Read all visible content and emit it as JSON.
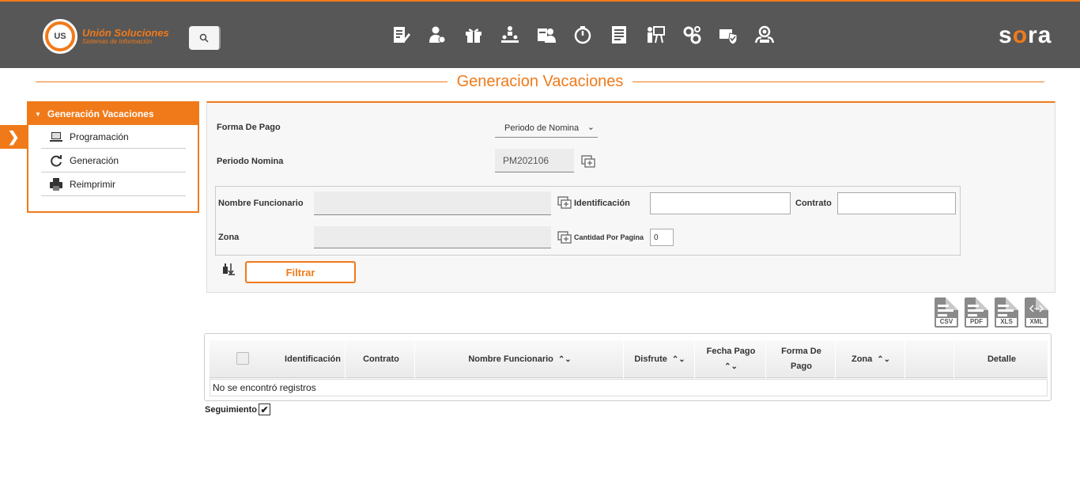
{
  "header": {
    "logo_mark": "US",
    "logo_title": "Unión Soluciones",
    "logo_subtitle": "Sistemas de Información",
    "brand_pre": "s",
    "brand_accent": "o",
    "brand_post": "ra",
    "modules": [
      "edit-doc-icon",
      "user-money-icon",
      "gift-icon",
      "org-chart-icon",
      "user-id-icon",
      "timer-icon",
      "document-list-icon",
      "presentation-icon",
      "gears-icon",
      "shield-check-icon",
      "team-search-icon"
    ]
  },
  "page": {
    "title": "Generacion Vacaciones"
  },
  "sidebar": {
    "title": "Generación Vacaciones",
    "items": [
      {
        "label": "Programación",
        "icon": "laptop-icon"
      },
      {
        "label": "Generación",
        "icon": "refresh-icon"
      },
      {
        "label": "Reimprimir",
        "icon": "printer-icon"
      }
    ]
  },
  "form": {
    "forma_pago_label": "Forma De Pago",
    "forma_pago_value": "Periodo de Nomina",
    "periodo_label": "Periodo Nomina",
    "periodo_value": "PM202106",
    "nombre_label": "Nombre Funcionario",
    "nombre_value": "",
    "identificacion_label": "Identificación",
    "identificacion_value": "",
    "contrato_label": "Contrato",
    "contrato_value": "",
    "zona_label": "Zona",
    "zona_value": "",
    "cantidad_label": "Cantidad Por Pagina",
    "cantidad_value": "0",
    "filtrar_label": "Filtrar"
  },
  "exports": [
    "CSV",
    "PDF",
    "XLS",
    "XML"
  ],
  "table": {
    "columns": [
      "Identificación",
      "Contrato",
      "Nombre Funcionario",
      "Disfrute",
      "Fecha Pago",
      "Forma De Pago",
      "Zona",
      "Detalle"
    ],
    "empty_message": "No se encontró registros"
  },
  "footer": {
    "seguimiento_label": "Seguimiento",
    "seguimiento_checked": true
  },
  "colors": {
    "accent": "#f07a1a",
    "topbar": "#575757"
  }
}
